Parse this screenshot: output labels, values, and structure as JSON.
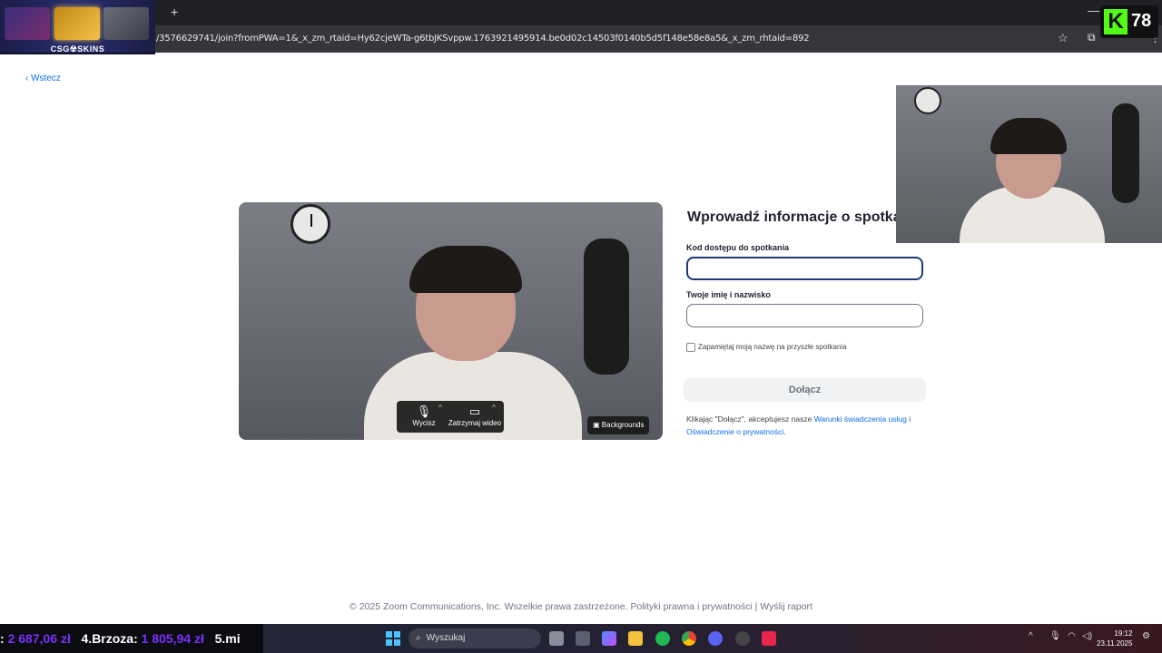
{
  "browser": {
    "new_tab_label": "+",
    "url": "/3576629741/join?fromPWA=1&_x_zm_rtaid=Hy62cjeWTa-g6tbJKSvppw.1763921495914.be0d02c14503f0140b5d5f148e58e8a5&_x_zm_rhtaid=892",
    "bookmark_icon": "star-icon",
    "extensions_icon": "puzzle-icon",
    "menu_icon": "kebab-menu-icon"
  },
  "overlay": {
    "skins_logo": "CSG☢SKINS",
    "k_badge_letter": "K",
    "k_badge_number": "78"
  },
  "page": {
    "back_label": "Wstecz",
    "form_title": "Wprowadź informacje o spotkaniu",
    "code_label": "Kod dostępu do spotkania",
    "code_value": "",
    "name_label": "Twoje imię i nazwisko",
    "name_value": "",
    "remember_label": "Zapamiętaj moją nazwę na przyszłe spotkania",
    "remember_checked": false,
    "join_label": "Dołącz",
    "terms_prefix": "Klikając \"Dołącz\", akceptujesz nasze ",
    "terms_link": "Warunki świadczenia usług",
    "terms_mid": " i ",
    "privacy_link": "Oświadczenie o prywatności",
    "terms_suffix": "."
  },
  "preview": {
    "mute_label": "Wycisz",
    "video_label": "Zatrzymaj wideo",
    "backgrounds_label": "Backgrounds"
  },
  "footer": {
    "text": "© 2025 Zoom Communications, Inc. Wszelkie prawa zastrzeżone. Polityki prawna i prywatności  |  Wyślij raport"
  },
  "taskbar": {
    "ticker_a": ": ",
    "ticker_a_value": "2 687,06 zł",
    "ticker_b": "4.Brzoza: ",
    "ticker_b_value": "1 805,94 zł",
    "ticker_c": "5.mi",
    "search_placeholder": "Wyszukaj",
    "time": "19:12",
    "date": "23.11.2025"
  },
  "colors": {
    "accent": "#0e71eb",
    "kick_green": "#53fc18",
    "ticker_purple": "#7b2fff"
  }
}
